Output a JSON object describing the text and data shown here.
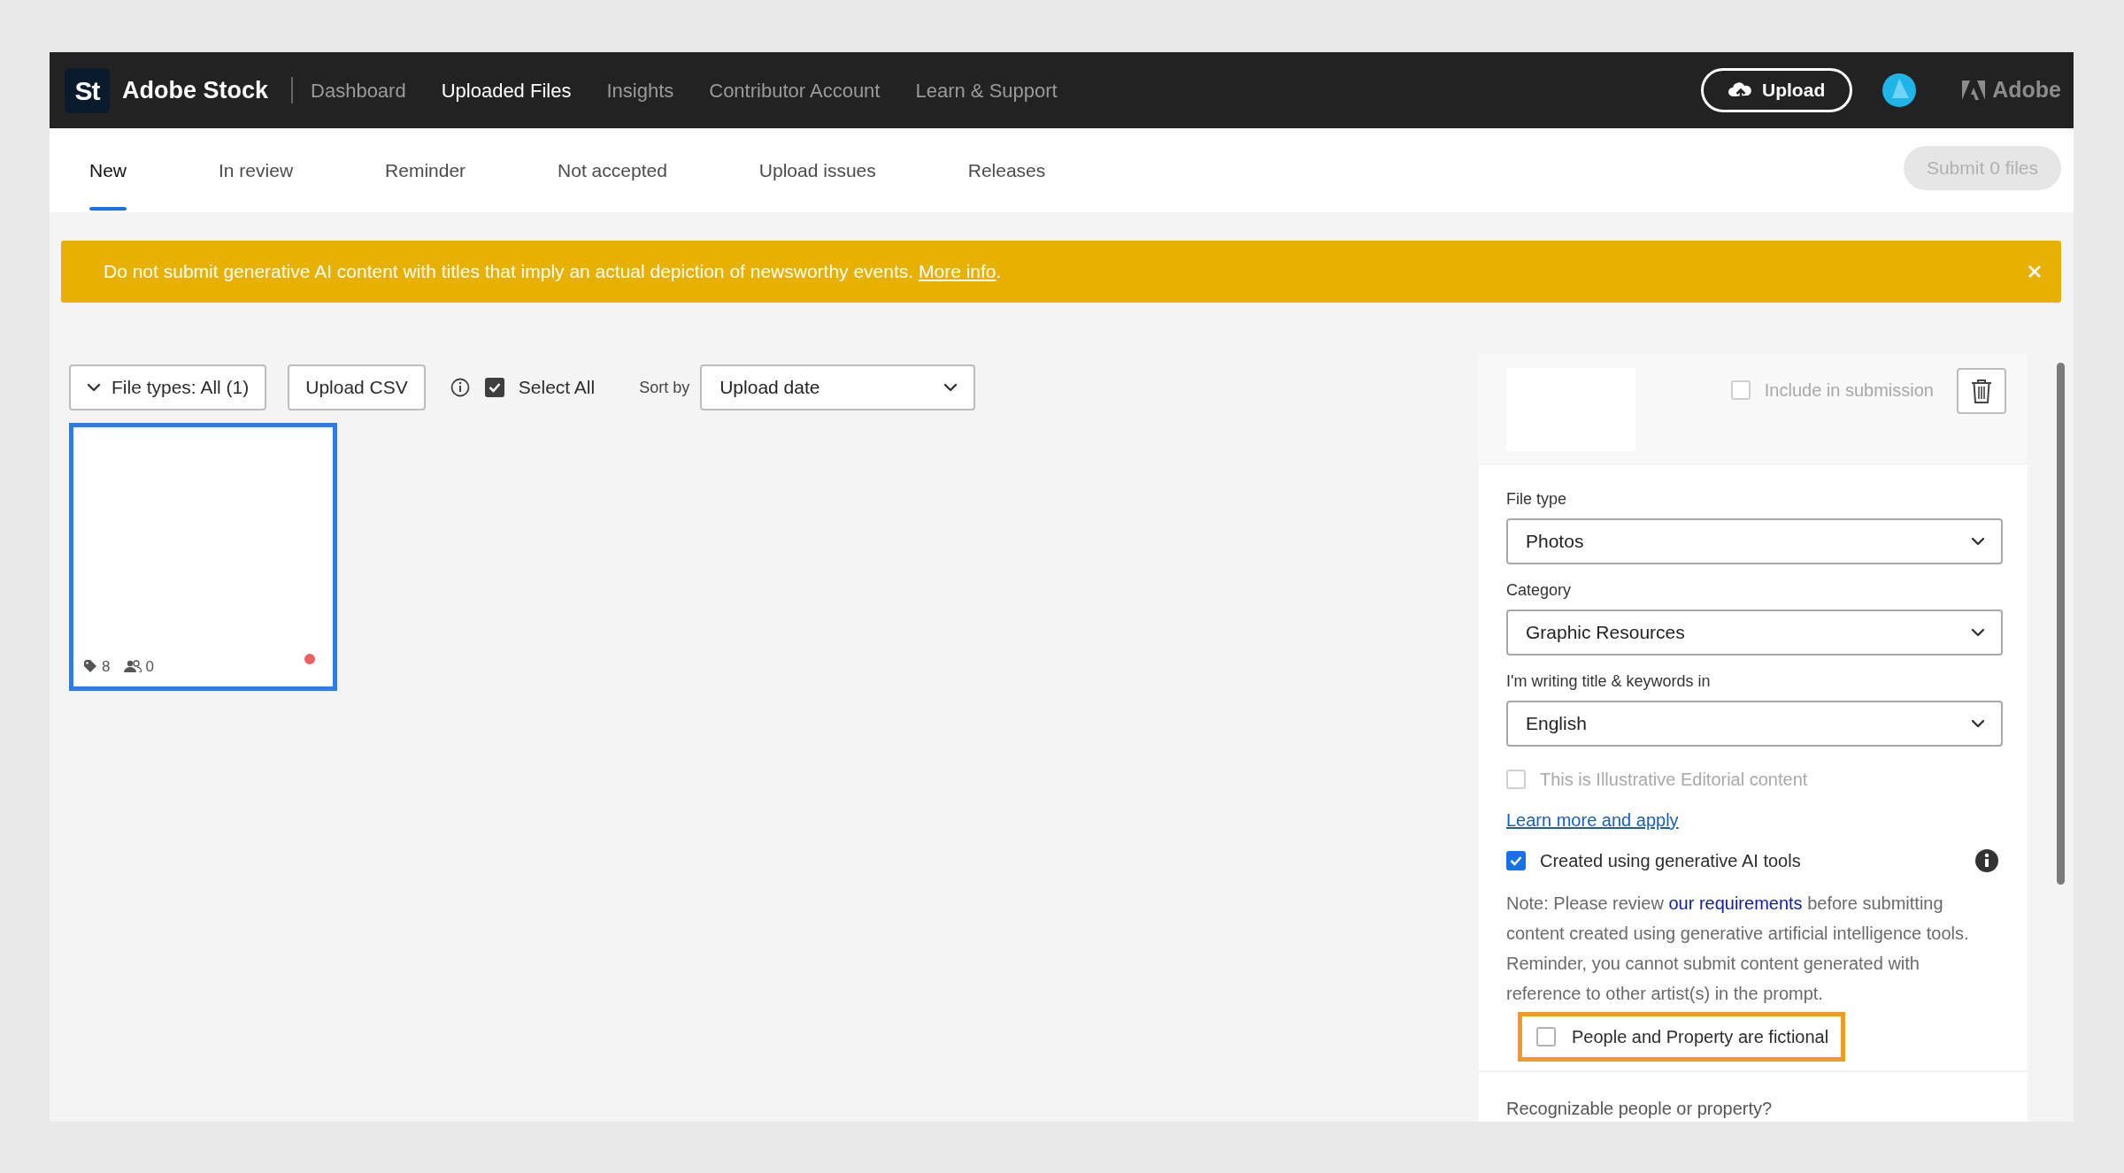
{
  "header": {
    "logo_mark": "St",
    "brand": "Adobe Stock",
    "nav": [
      {
        "label": "Dashboard",
        "selected": false
      },
      {
        "label": "Uploaded Files",
        "selected": true
      },
      {
        "label": "Insights",
        "selected": false
      },
      {
        "label": "Contributor Account",
        "selected": false
      },
      {
        "label": "Learn & Support",
        "selected": false
      }
    ],
    "upload_button": "Upload",
    "adobe_label": "Adobe"
  },
  "tabs": [
    {
      "label": "New",
      "selected": true
    },
    {
      "label": "In review",
      "selected": false
    },
    {
      "label": "Reminder",
      "selected": false
    },
    {
      "label": "Not accepted",
      "selected": false
    },
    {
      "label": "Upload issues",
      "selected": false
    },
    {
      "label": "Releases",
      "selected": false
    }
  ],
  "submit_button": {
    "label": "Submit 0 files",
    "disabled": true
  },
  "banner": {
    "text": "Do not submit generative AI content with titles that imply an actual depiction of newsworthy events. ",
    "link": "More info",
    "text_after": "."
  },
  "toolbar": {
    "file_types": "File types: All (1)",
    "upload_csv": "Upload CSV",
    "select_all": {
      "label": "Select All",
      "checked": true
    },
    "sort_label": "Sort by",
    "sort_value": "Upload date"
  },
  "files": [
    {
      "keywords": "8",
      "people": "0",
      "selected": true,
      "flagged": true
    }
  ],
  "panel": {
    "include": {
      "label": "Include in submission",
      "checked": false,
      "disabled": true
    },
    "fields": [
      {
        "label": "File type",
        "value": "Photos"
      },
      {
        "label": "Category",
        "value": "Graphic Resources"
      },
      {
        "label": "I'm writing title & keywords in",
        "value": "English"
      }
    ],
    "editorial": {
      "label": "This is Illustrative Editorial content",
      "checked": false,
      "disabled": true
    },
    "learn_link": "Learn more and apply",
    "ai": {
      "label": "Created using generative AI tools",
      "checked": true
    },
    "note": {
      "text": "Note: Please review ",
      "link": "our requirements",
      "text_after": " before submitting content created using generative artificial intelligence tools. Reminder, you cannot submit content generated with reference to other artist(s) in the prompt."
    },
    "fictional": {
      "label": "People and Property are fictional",
      "checked": false,
      "highlighted": true
    },
    "recognizable": "Recognizable people or property?"
  }
}
